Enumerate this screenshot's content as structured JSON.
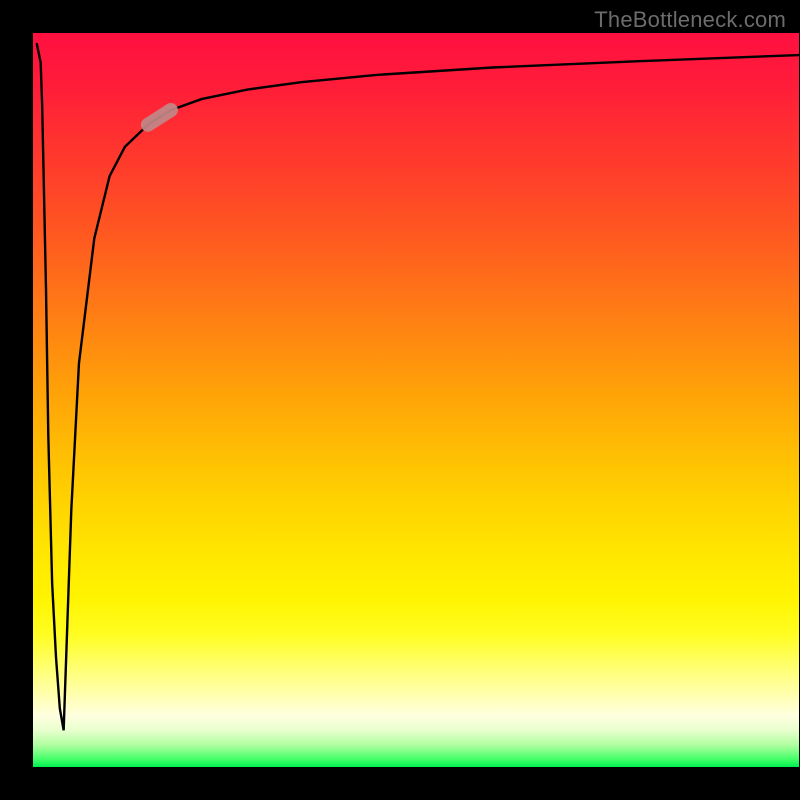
{
  "watermark": "TheBottleneck.com",
  "colors": {
    "frame": "#000000",
    "gradient_top": "#ff1040",
    "gradient_bottom": "#00f050",
    "curve": "#000000",
    "highlight": "#c28888"
  },
  "chart_data": {
    "type": "line",
    "title": "",
    "xlabel": "",
    "ylabel": "",
    "xlim": [
      0,
      100
    ],
    "ylim": [
      0,
      100
    ],
    "grid": false,
    "legend": false,
    "series": [
      {
        "name": "curve",
        "x": [
          0.5,
          1.0,
          1.2,
          1.4,
          1.7,
          2.0,
          2.5,
          3.0,
          3.5,
          4.0,
          5.0,
          6.0,
          8.0,
          10,
          12,
          15,
          18,
          22,
          28,
          35,
          45,
          60,
          80,
          100
        ],
        "y": [
          98.5,
          96.0,
          90.0,
          80.0,
          65.0,
          45.0,
          25.0,
          15.0,
          8.0,
          5.0,
          35.0,
          55.0,
          72.0,
          80.5,
          84.5,
          87.5,
          89.5,
          91.0,
          92.3,
          93.3,
          94.3,
          95.3,
          96.2,
          97.0
        ]
      }
    ],
    "highlight": {
      "x_range": [
        14.0,
        21.5
      ],
      "y_range": [
        86.5,
        90.5
      ]
    }
  }
}
